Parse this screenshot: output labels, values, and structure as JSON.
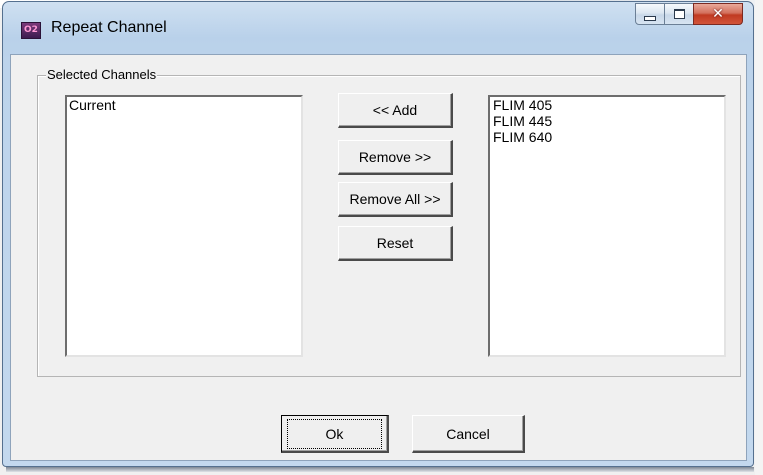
{
  "window": {
    "title": "Repeat Channel",
    "icon": "app-logo-icon",
    "icon_text": "O2",
    "caption_buttons": {
      "minimize": "minimize-icon",
      "maximize": "maximize-icon",
      "close": "close-icon"
    }
  },
  "group": {
    "label": "Selected Channels"
  },
  "selected_list": {
    "items": [
      "Current"
    ]
  },
  "available_list": {
    "items": [
      "FLIM 405",
      "FLIM 445",
      "FLIM 640"
    ]
  },
  "actions": {
    "add": "<< Add",
    "remove": "Remove >>",
    "remove_all": "Remove All >>",
    "reset": "Reset"
  },
  "footer": {
    "ok": "Ok",
    "cancel": "Cancel"
  }
}
